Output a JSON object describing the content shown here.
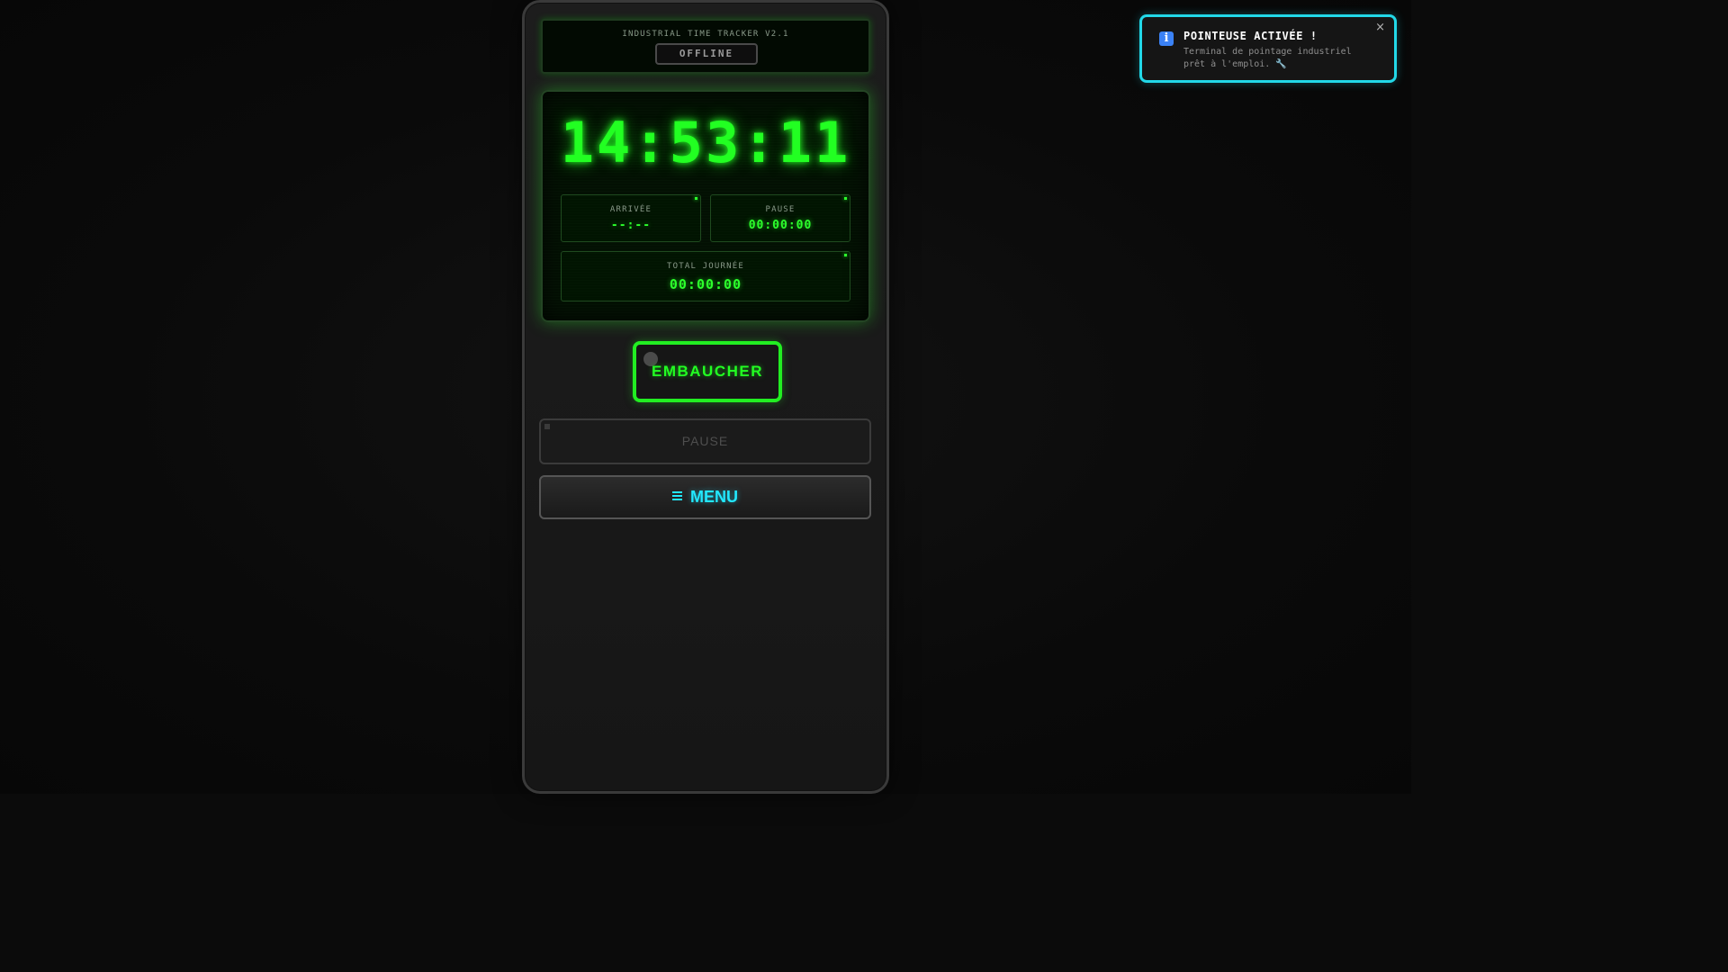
{
  "header": {
    "title": "INDUSTRIAL TIME TRACKER V2.1",
    "status": "OFFLINE"
  },
  "display": {
    "clock": "14:53:11",
    "arrivee": {
      "label": "ARRIVÉE",
      "value": "--:--"
    },
    "pause": {
      "label": "PAUSE",
      "value": "00:00:00"
    },
    "total": {
      "label": "TOTAL JOURNÉE",
      "value": "00:00:00"
    }
  },
  "buttons": {
    "embaucher": "EMBAUCHER",
    "pause": "PAUSE",
    "menu_icon": "≡",
    "menu": "MENU"
  },
  "toast": {
    "icon": "i",
    "title": "POINTEUSE ACTIVÉE !",
    "message": "Terminal de pointage industriel prêt à l'emploi. 🔧",
    "close": "×"
  },
  "colors": {
    "accent_green": "#22ff22",
    "accent_cyan": "#22e8ff",
    "info_blue": "#3b82f6"
  }
}
